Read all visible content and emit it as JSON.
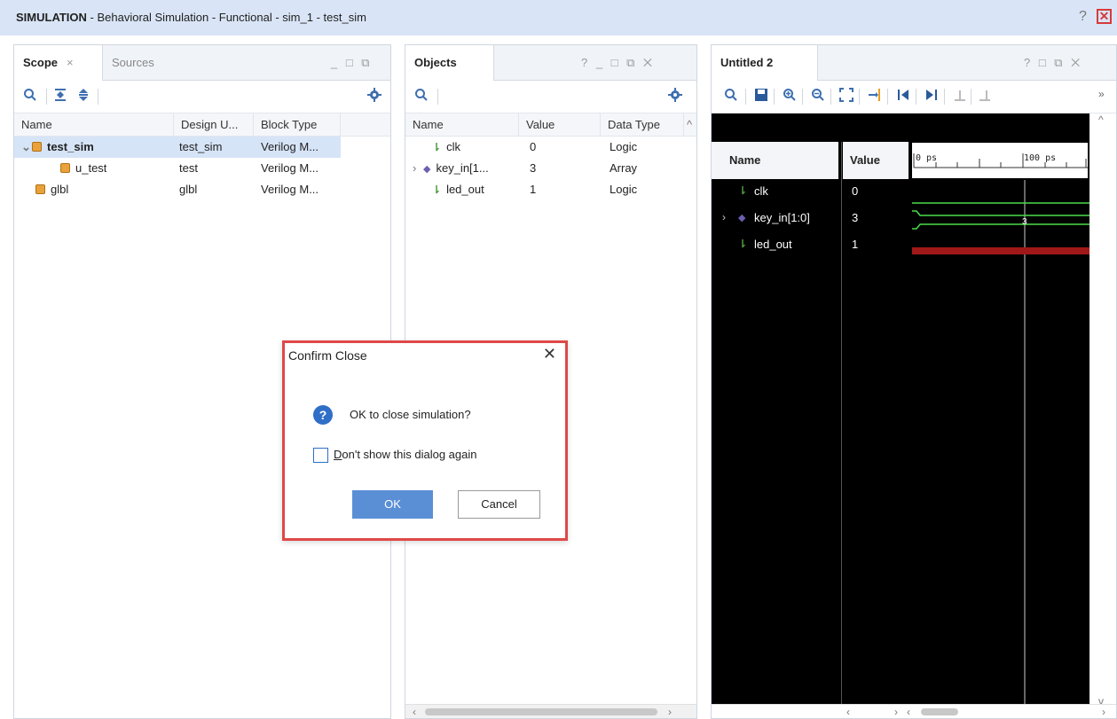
{
  "titlebar": {
    "mode": "SIMULATION",
    "rest": " - Behavioral Simulation - Functional - sim_1 - test_sim",
    "help": "?",
    "close": "✕"
  },
  "scope_panel": {
    "tabs": [
      "Scope",
      "Sources"
    ],
    "tab_close": "×",
    "controls": "_ □ ⧉",
    "columns": [
      "Name",
      "Design U...",
      "Block Type"
    ],
    "rows": [
      {
        "name": "test_sim",
        "design_unit": "test_sim",
        "block_type": "Verilog M...",
        "expanded": true,
        "selected": true
      },
      {
        "name": "u_test",
        "design_unit": "test",
        "block_type": "Verilog M..."
      },
      {
        "name": "glbl",
        "design_unit": "glbl",
        "block_type": "Verilog M..."
      }
    ]
  },
  "objects_panel": {
    "title": "Objects",
    "controls": "? _ □ ⧉ ✕",
    "columns": [
      "Name",
      "Value",
      "Data Type"
    ],
    "rows": [
      {
        "name": "clk",
        "value": "0",
        "type": "Logic"
      },
      {
        "name": "key_in[1...",
        "value": "3",
        "type": "Array"
      },
      {
        "name": "led_out",
        "value": "1",
        "type": "Logic"
      }
    ]
  },
  "wave_panel": {
    "title": "Untitled 2",
    "controls": "? □ ⧉ ✕",
    "more": "»",
    "name_header": "Name",
    "value_header": "Value",
    "time_labels": [
      "0 ps",
      "100 ps"
    ],
    "signals": [
      {
        "name": "clk",
        "value": "0"
      },
      {
        "name": "key_in[1:0]",
        "value": "3",
        "bus_label": "3"
      },
      {
        "name": "led_out",
        "value": "1"
      }
    ]
  },
  "dialog": {
    "title": "Confirm Close",
    "close": "✕",
    "message": "OK to close simulation?",
    "checkbox_prefix": "D",
    "checkbox_rest": "on't show this dialog again",
    "ok": "OK",
    "cancel": "Cancel",
    "checked": false
  },
  "colors": {
    "title_bg": "#d9e5f6",
    "accent": "#3e6fb0",
    "dialog_border": "#e04848",
    "wave_green": "#4ade4a",
    "wave_red": "#a01818"
  }
}
